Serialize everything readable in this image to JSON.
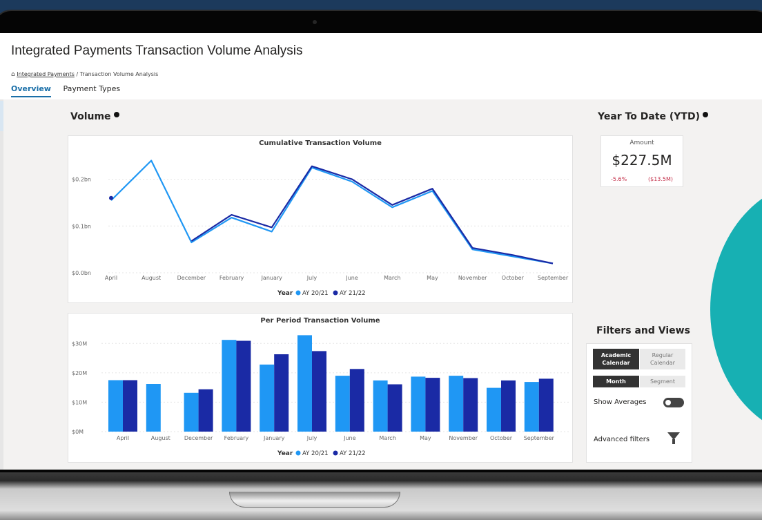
{
  "header": {
    "title": "Integrated Payments Transaction Volume Analysis",
    "breadcrumb": {
      "link": "Integrated Payments",
      "separator": "/",
      "current": "Transaction Volume Analysis"
    },
    "tabs": [
      {
        "label": "Overview",
        "active": true
      },
      {
        "label": "Payment Types",
        "active": false
      }
    ]
  },
  "volume": {
    "title": "Volume"
  },
  "ytd": {
    "title": "Year To Date (YTD)",
    "label": "Amount",
    "value": "$227.5M",
    "change_pct": "-5.6%",
    "change_amt": "($13.5M)"
  },
  "filters": {
    "title": "Filters and Views",
    "calendar": {
      "academic": "Academic Calendar",
      "regular": "Regular Calendar"
    },
    "period": {
      "month": "Month",
      "segment": "Segment"
    },
    "show_averages": "Show Averages",
    "show_averages_on": false,
    "advanced": "Advanced filters"
  },
  "legend": {
    "title": "Year",
    "items": [
      "AY 20/21",
      "AY 21/22"
    ]
  },
  "colors": {
    "series1": "#1f97f4",
    "series2": "#1a2aa5",
    "accent": "#1a6fa8",
    "negative": "#c4314b"
  },
  "chart_data": [
    {
      "type": "line",
      "title": "Cumulative Transaction Volume",
      "categories": [
        "April",
        "August",
        "December",
        "February",
        "January",
        "July",
        "June",
        "March",
        "May",
        "November",
        "October",
        "September"
      ],
      "series": [
        {
          "name": "AY 20/21",
          "values": [
            0.155,
            0.24,
            0.065,
            0.118,
            0.088,
            0.225,
            0.195,
            0.14,
            0.175,
            0.05,
            0.035,
            0.02
          ]
        },
        {
          "name": "AY 21/22",
          "values": [
            0.16,
            null,
            0.068,
            0.124,
            0.097,
            0.228,
            0.2,
            0.145,
            0.18,
            0.053,
            0.038,
            0.02
          ]
        }
      ],
      "yticks": [
        "$0.0bn",
        "$0.1bn",
        "$0.2bn"
      ],
      "ylim": [
        0,
        0.26
      ],
      "legend_position": "bottom"
    },
    {
      "type": "bar",
      "title": "Per Period Transaction Volume",
      "categories": [
        "April",
        "August",
        "December",
        "February",
        "January",
        "July",
        "June",
        "March",
        "May",
        "November",
        "October",
        "September"
      ],
      "series": [
        {
          "name": "AY 20/21",
          "values": [
            17.5,
            16.2,
            13.2,
            31.2,
            22.8,
            32.8,
            19.0,
            17.4,
            18.7,
            19.0,
            14.9,
            16.9
          ]
        },
        {
          "name": "AY 21/22",
          "values": [
            17.5,
            null,
            14.4,
            30.9,
            26.3,
            27.4,
            21.3,
            16.1,
            18.3,
            18.2,
            17.4,
            18.0
          ]
        }
      ],
      "yticks": [
        "$0M",
        "$10M",
        "$20M",
        "$30M"
      ],
      "ylim": [
        0,
        35
      ],
      "legend_position": "bottom"
    }
  ]
}
